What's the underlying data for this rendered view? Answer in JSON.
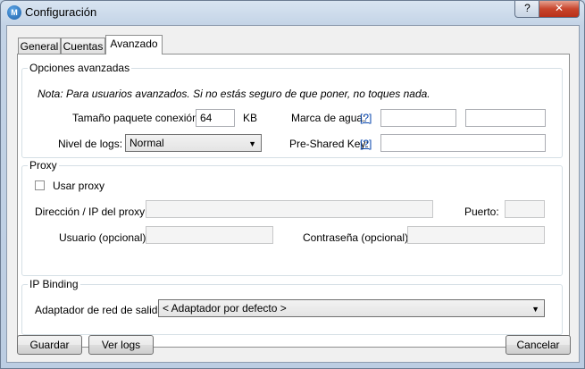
{
  "window": {
    "title": "Configuración",
    "help_label": "?",
    "close_label": "✕"
  },
  "tabs": [
    {
      "label": "General"
    },
    {
      "label": "Cuentas"
    },
    {
      "label": "Avanzado",
      "active": true
    }
  ],
  "advanced": {
    "title": "Opciones avanzadas",
    "note": "Nota: Para usuarios avanzados. Si no estás seguro de que poner, no toques nada.",
    "packet_size_label": "Tamaño paquete conexión:",
    "packet_size_value": "64",
    "packet_size_unit": "KB",
    "watermark_label": "Marca de agua:",
    "watermark_help": "[?]",
    "watermark_value_1": "",
    "watermark_value_2": "",
    "log_level_label": "Nivel de logs:",
    "log_level_value": "Normal",
    "psk_label": "Pre-Shared Key:",
    "psk_help": "[?]",
    "psk_value": ""
  },
  "proxy": {
    "title": "Proxy",
    "use_proxy_label": "Usar proxy",
    "use_proxy_checked": false,
    "address_label": "Dirección / IP del proxy:",
    "address_value": "",
    "port_label": "Puerto:",
    "port_value": "",
    "user_label": "Usuario (opcional):",
    "user_value": "",
    "password_label": "Contraseña (opcional):",
    "password_value": ""
  },
  "ip_binding": {
    "title": "IP Binding",
    "adapter_label": "Adaptador de red de salida:",
    "adapter_value": "< Adaptador por defecto >"
  },
  "footer": {
    "save_label": "Guardar",
    "logs_label": "Ver logs",
    "cancel_label": "Cancelar"
  }
}
